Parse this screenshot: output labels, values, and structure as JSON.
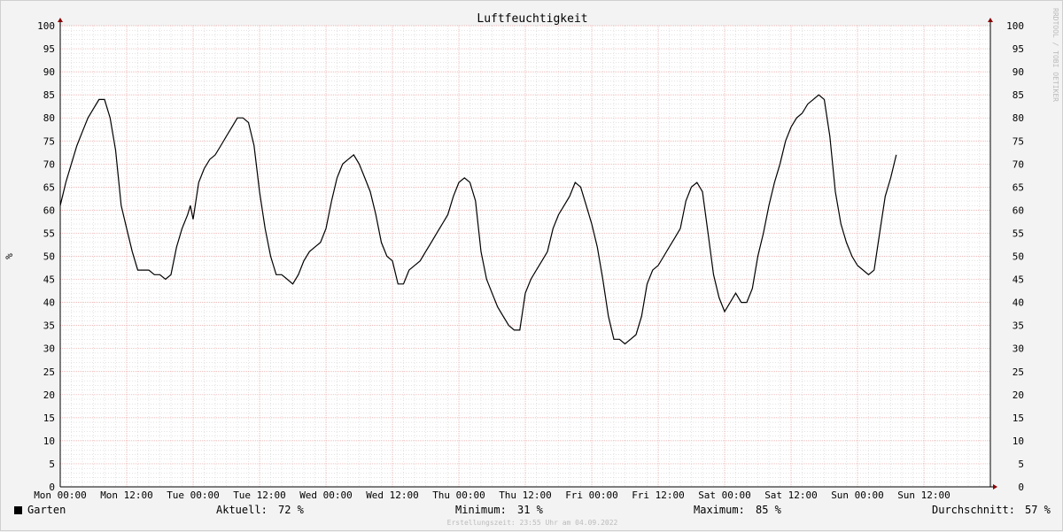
{
  "chart_data": {
    "type": "line",
    "title": "Luftfeuchtigkeit",
    "ylabel": "%",
    "side_label": "RRDTOOL / TOBI OETIKER",
    "ylim": [
      0,
      100
    ],
    "ytick_step": 5,
    "x_tick_labels": [
      "Mon 00:00",
      "Mon 12:00",
      "Tue 00:00",
      "Tue 12:00",
      "Wed 00:00",
      "Wed 12:00",
      "Thu 00:00",
      "Thu 12:00",
      "Fri 00:00",
      "Fri 12:00",
      "Sat 00:00",
      "Sat 12:00",
      "Sun 00:00",
      "Sun 12:00"
    ],
    "x_range_hours": [
      0,
      168
    ],
    "grid": true,
    "series": [
      {
        "name": "Garten",
        "color": "#000000",
        "x_hours": [
          0,
          1,
          2,
          3,
          4,
          5,
          6,
          7,
          8,
          9,
          10,
          11,
          12,
          13,
          14,
          15,
          16,
          17,
          18,
          19,
          20,
          21,
          22,
          23,
          23.5,
          24,
          25,
          26,
          27,
          28,
          29,
          30,
          31,
          32,
          33,
          34,
          35,
          36,
          37,
          38,
          39,
          40,
          41,
          42,
          43,
          44,
          45,
          46,
          47,
          48,
          49,
          50,
          51,
          52,
          53,
          54,
          55,
          56,
          57,
          58,
          59,
          60,
          61,
          62,
          63,
          64,
          65,
          66,
          67,
          68,
          69,
          70,
          71,
          72,
          73,
          74,
          75,
          76,
          77,
          78,
          79,
          80,
          81,
          82,
          83,
          84,
          85,
          86,
          87,
          88,
          89,
          90,
          91,
          92,
          93,
          94,
          95,
          96,
          97,
          98,
          99,
          100,
          101,
          102,
          103,
          104,
          105,
          106,
          107,
          108,
          109,
          110,
          111,
          112,
          113,
          114,
          115,
          116,
          117,
          118,
          119,
          120,
          121,
          122,
          123,
          124,
          125,
          126,
          127,
          128,
          129,
          130,
          131,
          132,
          133,
          134,
          135,
          136,
          137,
          138,
          139,
          140,
          141,
          142,
          143,
          144,
          145,
          146,
          147,
          148,
          149,
          150,
          151,
          152,
          153,
          154,
          155,
          156,
          157,
          158,
          159,
          160,
          161,
          162,
          163,
          164,
          165,
          166,
          167
        ],
        "values": [
          61,
          66,
          70,
          74,
          77,
          80,
          82,
          84,
          84,
          80,
          73,
          61,
          56,
          51,
          47,
          47,
          47,
          46,
          46,
          45,
          46,
          52,
          56,
          59,
          61,
          58,
          66,
          69,
          71,
          72,
          74,
          76,
          78,
          80,
          80,
          79,
          74,
          64,
          56,
          50,
          46,
          46,
          45,
          44,
          46,
          49,
          51,
          52,
          53,
          56,
          62,
          67,
          70,
          71,
          72,
          70,
          67,
          64,
          59,
          53,
          50,
          49,
          44,
          44,
          47,
          48,
          49,
          51,
          53,
          55,
          57,
          59,
          63,
          66,
          67,
          66,
          62,
          51,
          45,
          42,
          39,
          37,
          35,
          34,
          34,
          42,
          45,
          47,
          49,
          51,
          56,
          59,
          61,
          63,
          66,
          65,
          61,
          57,
          52,
          45,
          37,
          32,
          32,
          31,
          32,
          33,
          37,
          44,
          47,
          48,
          50,
          52,
          54,
          56,
          62,
          65,
          66,
          64,
          55,
          46,
          41,
          38,
          40,
          42,
          40,
          40,
          43,
          50,
          55,
          61,
          66,
          70,
          75,
          78,
          80,
          81,
          83,
          84,
          85,
          84,
          76,
          64,
          57,
          53,
          50,
          48,
          47,
          46,
          47,
          55,
          63,
          67,
          72
        ]
      }
    ],
    "stats": [
      {
        "label": "Aktuell:",
        "value": "72 %"
      },
      {
        "label": "Minimum:",
        "value": "31 %"
      },
      {
        "label": "Maximum:",
        "value": "85 %"
      },
      {
        "label": "Durchschnitt:",
        "value": "57 %"
      }
    ],
    "footer": "Erstellungszeit: 23:55 Uhr am 04.09.2022",
    "colors": {
      "background": "#f3f3f3",
      "plot": "#ffffff",
      "minor_grid": "#c8c8c8",
      "major_grid": "#e8a0a0",
      "axis_arrow": "#8b0000",
      "line": "#000000"
    }
  }
}
